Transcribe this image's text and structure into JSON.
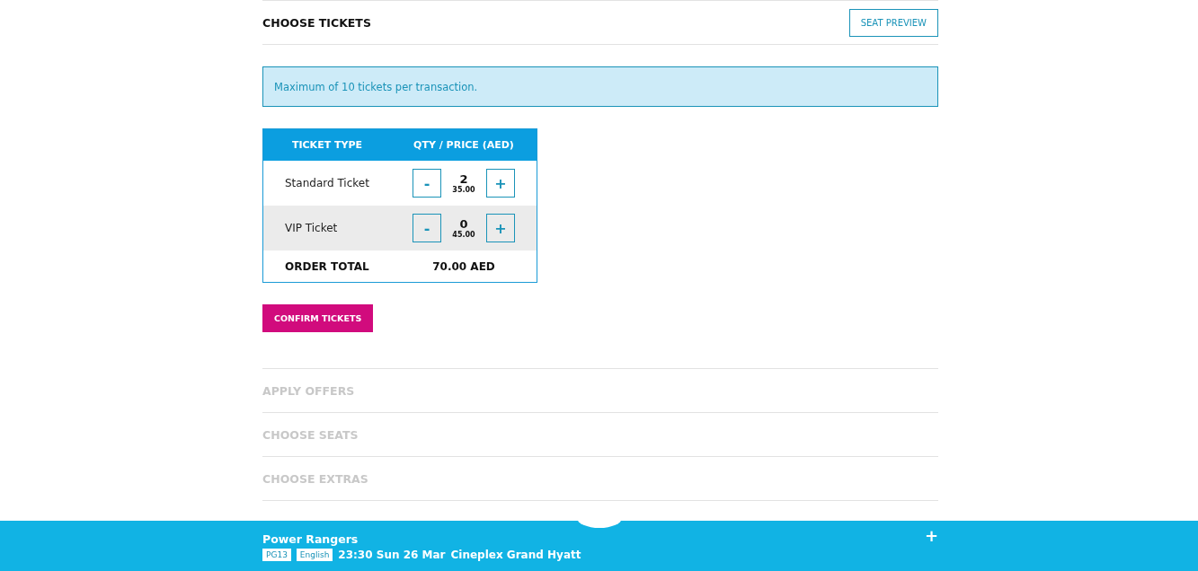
{
  "header": {
    "title": "CHOOSE TICKETS",
    "button": "SEAT PREVIEW"
  },
  "notice": "Maximum of 10 tickets per transaction.",
  "ticket_table": {
    "columns": [
      "TICKET TYPE",
      "QTY / PRICE (AED)"
    ],
    "rows": [
      {
        "name": "Standard Ticket",
        "qty": "2",
        "price": "35.00",
        "minus": "-",
        "plus": "+"
      },
      {
        "name": "VIP Ticket",
        "qty": "0",
        "price": "45.00",
        "minus": "-",
        "plus": "+"
      }
    ],
    "total_label": "ORDER TOTAL",
    "total": "70.00 AED"
  },
  "confirm_button": "CONFIRM TICKETS",
  "steps": [
    {
      "label": "APPLY OFFERS",
      "disabled": true
    },
    {
      "label": "CHOOSE SEATS",
      "disabled": true
    },
    {
      "label": "CHOOSE EXTRAS",
      "disabled": true
    }
  ],
  "footer": {
    "title": "Power Rangers",
    "tags": [
      "PG13",
      "English"
    ],
    "showtime": "23:30 Sun 26 Mar",
    "cinema": "Cineplex Grand Hyatt",
    "expand": "+"
  }
}
